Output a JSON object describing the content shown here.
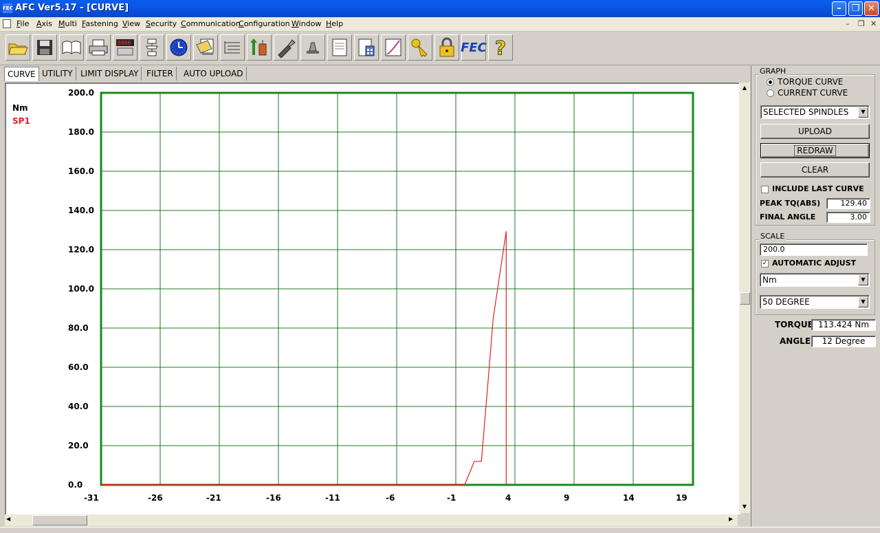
{
  "window": {
    "title": "AFC Ver5.17 - [CURVE]",
    "app_icon_text": "FEC"
  },
  "menu": [
    {
      "label": "File",
      "u": "F"
    },
    {
      "label": "Axis",
      "u": "A"
    },
    {
      "label": "Multi",
      "u": "M"
    },
    {
      "label": "Fastening",
      "u": "F"
    },
    {
      "label": "View",
      "u": "V"
    },
    {
      "label": "Security",
      "u": "S"
    },
    {
      "label": "Communication",
      "u": "C"
    },
    {
      "label": "Configuration",
      "u": "C"
    },
    {
      "label": "Window",
      "u": "W"
    },
    {
      "label": "Help",
      "u": "H"
    }
  ],
  "toolbar": [
    {
      "icon": "open-folder-icon"
    },
    {
      "icon": "save-disk-icon"
    },
    {
      "icon": "manual-book-icon"
    },
    {
      "icon": "printer-icon"
    },
    {
      "icon": "digital-display-icon"
    },
    {
      "icon": "flowchart-icon"
    },
    {
      "icon": "clock-icon"
    },
    {
      "icon": "data-sheet-icon"
    },
    {
      "icon": "list-tree-icon"
    },
    {
      "icon": "transfer-arrows-icon"
    },
    {
      "icon": "wrench-tool-icon"
    },
    {
      "icon": "alarm-lamp-icon"
    },
    {
      "icon": "document-icon"
    },
    {
      "icon": "calculator-sheet-icon"
    },
    {
      "icon": "curve-graph-icon"
    },
    {
      "icon": "key-icon"
    },
    {
      "icon": "padlock-icon"
    },
    {
      "icon": "fec-logo-icon",
      "text": "FEC"
    },
    {
      "icon": "help-question-icon",
      "text": "?"
    }
  ],
  "tabs": [
    "CURVE",
    "UTILITY",
    "LIMIT DISPLAY",
    "FILTER",
    "AUTO UPLOAD"
  ],
  "chart_data": {
    "type": "line",
    "ylabel": "Nm",
    "ylim": [
      0,
      200
    ],
    "xlim": [
      -31,
      19
    ],
    "y_ticks": [
      "200.0",
      "180.0",
      "160.0",
      "140.0",
      "120.0",
      "100.0",
      "80.0",
      "60.0",
      "40.0",
      "20.0",
      "0.0"
    ],
    "x_ticks": [
      "-31",
      "-26",
      "-21",
      "-16",
      "-11",
      "-6",
      "-1",
      "4",
      "9",
      "14",
      "19"
    ],
    "series": [
      {
        "name": "SP1",
        "color": "#e02020",
        "points": [
          [
            -31,
            0.2
          ],
          [
            -0.2,
            0.2
          ],
          [
            0.6,
            12
          ],
          [
            1.2,
            12
          ],
          [
            1.7,
            48
          ],
          [
            2.2,
            85
          ],
          [
            3.3,
            129.4
          ],
          [
            3.3,
            0
          ]
        ]
      }
    ],
    "grid_color": "#1f7a1f",
    "frame_color": "#1a8a1a",
    "grid": true
  },
  "panel": {
    "graph_group": "GRAPH",
    "torque_curve": "TORQUE CURVE",
    "current_curve": "CURRENT CURVE",
    "spindle_select": "SELECTED SPINDLES",
    "upload": "UPLOAD",
    "redraw": "REDRAW",
    "clear": "CLEAR",
    "include_last": "INCLUDE LAST CURVE",
    "peak_label": "PEAK TQ(ABS)",
    "peak_value": "129.40",
    "final_label": "FINAL ANGLE",
    "final_value": "3.00",
    "scale_group": "SCALE",
    "scale_value": "200.0",
    "auto_adjust": "AUTOMATIC ADJUST",
    "unit_select": "Nm",
    "degree_select": "50 DEGREE",
    "torque_label": "TORQUE:",
    "torque_value": "113.424 Nm",
    "angle_label": "ANGLE :",
    "angle_value": "12 Degree"
  }
}
